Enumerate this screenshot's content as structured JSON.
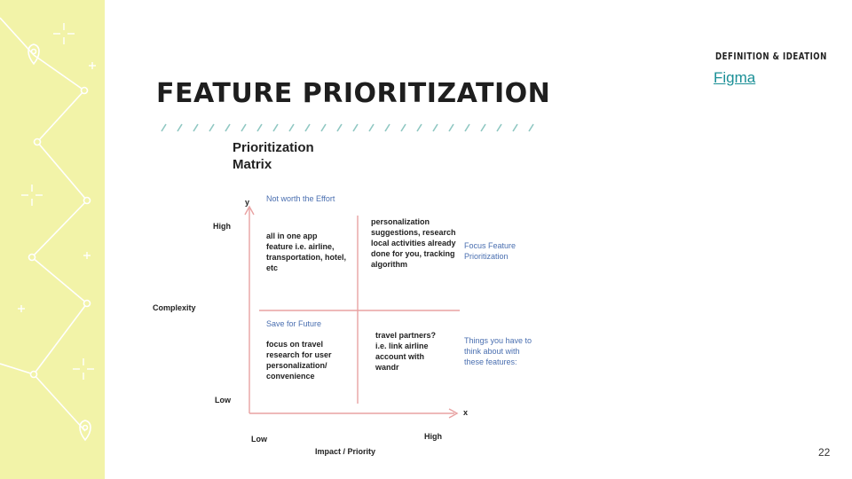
{
  "slide": {
    "section_label": "DEFINITION & IDEATION",
    "link_text": "Figma",
    "title": "FEATURE PRIORITIZATION",
    "page_number": "22"
  },
  "matrix": {
    "title": "Prioritization Matrix",
    "y_axis_letter": "y",
    "x_axis_letter": "x",
    "y_high": "High",
    "y_low": "Low",
    "y_label": "Complexity",
    "x_low": "Low",
    "x_high": "High",
    "x_label": "Impact / Priority",
    "quadrants": {
      "top_left_heading": "Not worth the Effort",
      "top_left_text": "all in one app feature i.e. airline, transportation, hotel, etc",
      "top_right_text": "personalization suggestions, research local activities already done for you, tracking algorithm",
      "bottom_left_heading": "Save for Future",
      "bottom_left_text": "focus on travel research for user personalization/ convenience",
      "bottom_right_text": "travel partners? i.e. link airline account with wandr"
    },
    "side_notes": {
      "focus": "Focus Feature Prioritization",
      "think": "Things you have to think about with these features:"
    }
  },
  "colors": {
    "sidebar_bg": "#f2f3a8",
    "axis_line": "#e8a2a2",
    "blue_text": "#4a6fb0",
    "link": "#1a8f96",
    "dash": "#8fc7c2"
  }
}
